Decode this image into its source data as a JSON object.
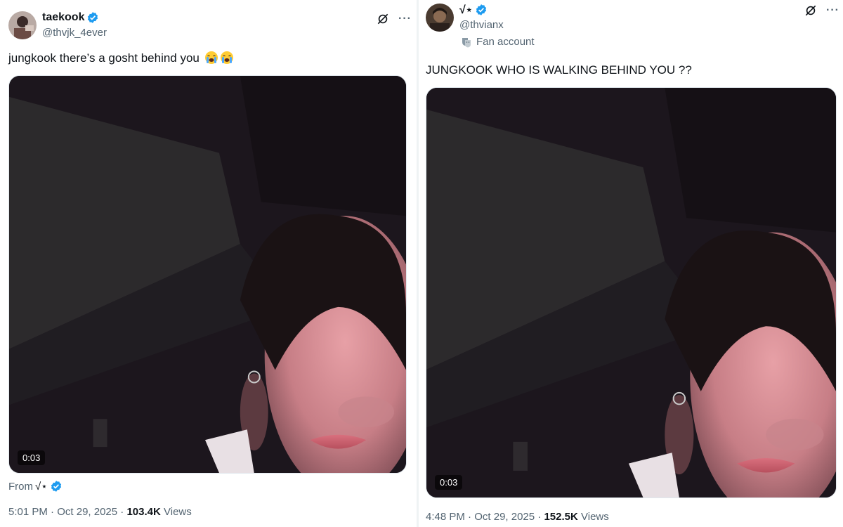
{
  "colors": {
    "verified": "#1d9bf0",
    "text": "#0f1419",
    "secondary": "#536471"
  },
  "left_tweet": {
    "display_name": "taekook",
    "handle": "@thvjk_4ever",
    "text": "jungkook there’s a gosht behind you",
    "emoji": "loudly-crying-face",
    "video_duration": "0:03",
    "from_label": "From",
    "from_name": "√⋆",
    "time": "5:01 PM",
    "date": "Oct 29, 2025",
    "views_count": "103.4K",
    "views_label": "Views"
  },
  "right_tweet": {
    "display_name": "√⋆",
    "handle": "@thvianx",
    "badge_label": "Fan account",
    "text": "JUNGKOOK WHO IS WALKING BEHIND YOU ??",
    "video_duration": "0:03",
    "time": "4:48 PM",
    "date": "Oct 29, 2025",
    "views_count": "152.5K",
    "views_label": "Views"
  }
}
